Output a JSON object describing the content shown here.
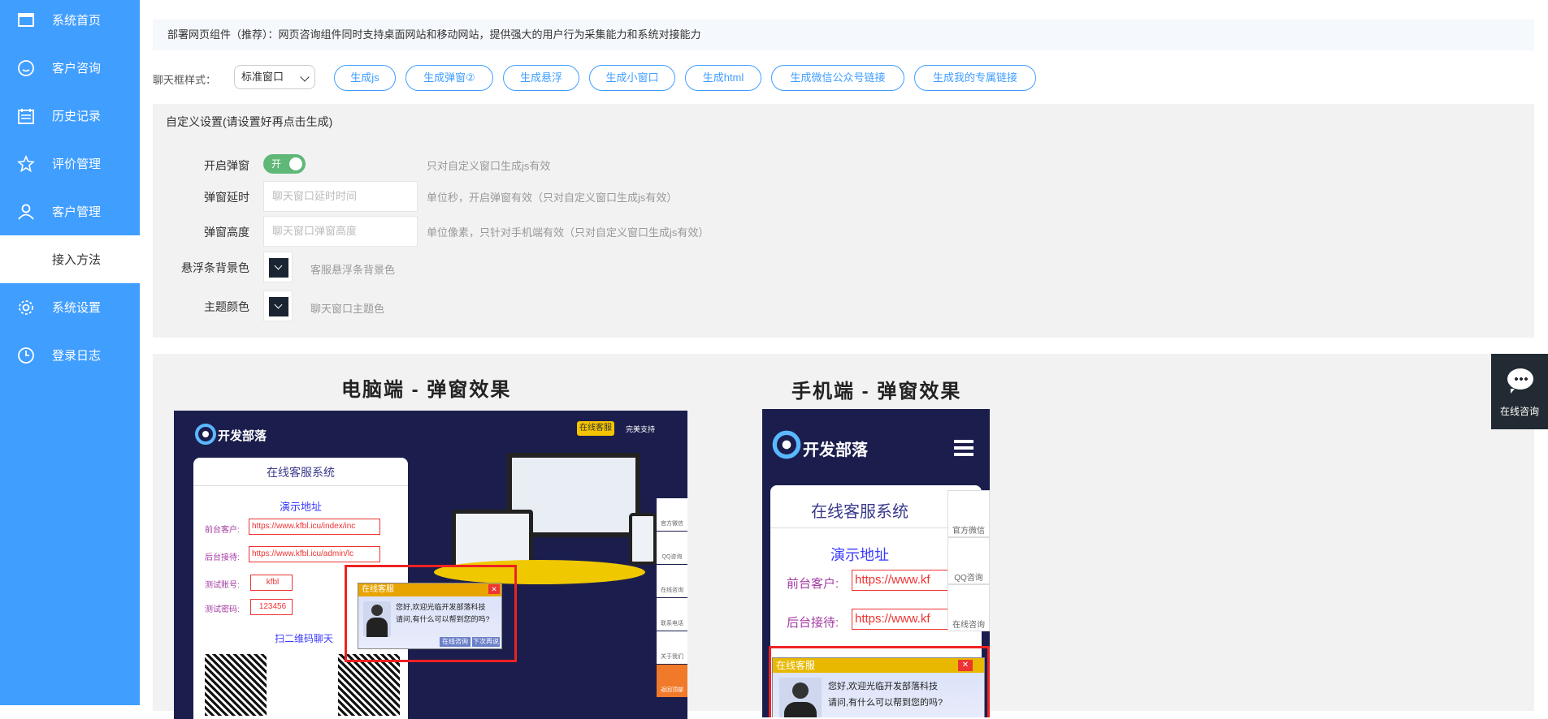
{
  "sidebar": {
    "items": [
      {
        "label": "系统首页",
        "icon": "monitor-icon"
      },
      {
        "label": "客户咨询",
        "icon": "smile-icon"
      },
      {
        "label": "历史记录",
        "icon": "calendar-icon"
      },
      {
        "label": "评价管理",
        "icon": "star-icon"
      },
      {
        "label": "客户管理",
        "icon": "user-icon"
      },
      {
        "label": "接入方法",
        "icon": "",
        "active": true
      },
      {
        "label": "系统设置",
        "icon": "gear-icon"
      },
      {
        "label": "登录日志",
        "icon": "clock-icon"
      }
    ],
    "color": "#409eff"
  },
  "notice": "部署网页组件（推荐）：网页咨询组件同时支持桌面网站和移动网站，提供强大的用户行为采集能力和系统对接能力",
  "chat_style": {
    "label": "聊天框样式：",
    "selected": "标准窗口"
  },
  "gen_buttons": [
    "生成js",
    "生成弹窗②",
    "生成悬浮",
    "生成小窗口",
    "生成html",
    "生成微信公众号链接",
    "生成我的专属链接"
  ],
  "settings": {
    "title": "自定义设置(请设置好再点击生成)",
    "popup_enable": {
      "label": "开启弹窗",
      "toggle_text": "开",
      "hint": "只对自定义窗口生成js有效"
    },
    "popup_delay": {
      "label": "弹窗延时",
      "placeholder": "聊天窗口延时时间",
      "hint": "单位秒，开启弹窗有效（只对自定义窗口生成js有效）"
    },
    "popup_height": {
      "label": "弹窗高度",
      "placeholder": "聊天窗口弹窗高度",
      "hint": "单位像素，只针对手机端有效（只对自定义窗口生成js有效）"
    },
    "float_bg": {
      "label": "悬浮条背景色",
      "hint": "客服悬浮条背景色"
    },
    "theme_color": {
      "label": "主题颜色",
      "hint": "聊天窗口主题色"
    }
  },
  "preview": {
    "pc_title": "电脑端 - 弹窗效果",
    "mobile_title": "手机端 - 弹窗效果",
    "pc": {
      "logo": "开发部落",
      "badge": "在线客服",
      "badge2": "完美支持",
      "card_title": "在线客服系统",
      "card_sub": "演示地址",
      "fields": [
        {
          "label": "前台客户:",
          "value": "https://www.kfbl.icu/index/inc"
        },
        {
          "label": "后台接待:",
          "value": "https://www.kfbl.icu/admin/lc"
        },
        {
          "label": "测试账号:",
          "value": "kfbl"
        },
        {
          "label": "测试密码:",
          "value": "123456"
        }
      ],
      "qr_label": "扫二维码聊天",
      "popup_title": "在线客服",
      "popup_msg1": "您好,欢迎光临开发部落科技",
      "popup_msg2": "请问,有什么可以帮到您的吗?",
      "popup_btn1": "在线咨询",
      "popup_btn2": "下次再说",
      "side": [
        "官方微信",
        "QQ咨询",
        "在线咨询",
        "联系电话",
        "关于我们",
        "返回顶部"
      ]
    },
    "mobile": {
      "logo": "开发部落",
      "card_title": "在线客服系统",
      "card_sub": "演示地址",
      "fields": [
        {
          "label": "前台客户:",
          "value": "https://www.kf"
        },
        {
          "label": "后台接待:",
          "value": "https://www.kf"
        }
      ],
      "side": [
        "官方微信",
        "QQ咨询",
        "在线咨询"
      ],
      "popup_title": "在线客服",
      "popup_msg1": "您好,欢迎光临开发部落科技",
      "popup_msg2": "请问,有什么可以帮到您的吗?"
    }
  },
  "float_chat": {
    "label": "在线咨询"
  }
}
